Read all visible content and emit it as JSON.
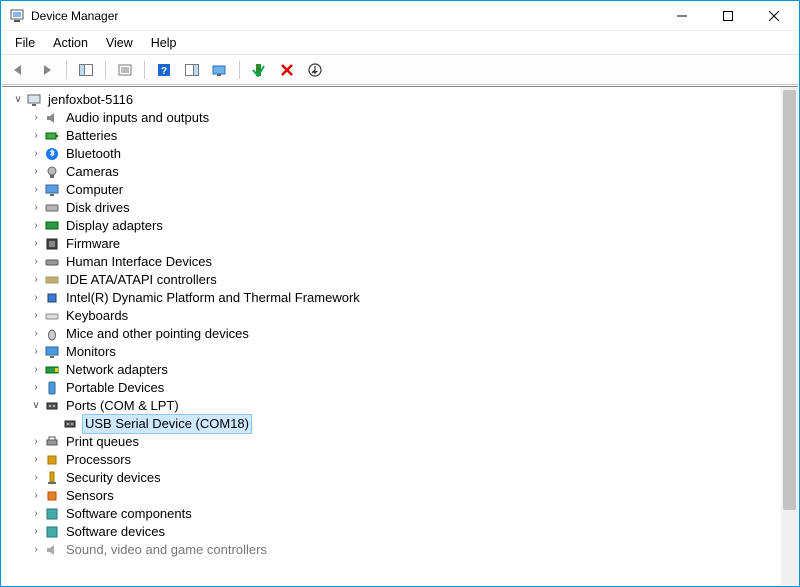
{
  "window": {
    "title": "Device Manager"
  },
  "menu": {
    "file": "File",
    "action": "Action",
    "view": "View",
    "help": "Help"
  },
  "tree": {
    "root": "jenfoxbot-5116",
    "items": {
      "audio": "Audio inputs and outputs",
      "batteries": "Batteries",
      "bluetooth": "Bluetooth",
      "cameras": "Cameras",
      "computer": "Computer",
      "disk": "Disk drives",
      "display": "Display adapters",
      "firmware": "Firmware",
      "hid": "Human Interface Devices",
      "ide": "IDE ATA/ATAPI controllers",
      "intel": "Intel(R) Dynamic Platform and Thermal Framework",
      "keyboards": "Keyboards",
      "mice": "Mice and other pointing devices",
      "monitors": "Monitors",
      "network": "Network adapters",
      "portable": "Portable Devices",
      "ports": "Ports (COM & LPT)",
      "ports_child": "USB Serial Device (COM18)",
      "printq": "Print queues",
      "processors": "Processors",
      "security": "Security devices",
      "sensors": "Sensors",
      "swcomp": "Software components",
      "swdev": "Software devices",
      "sound": "Sound, video and game controllers"
    }
  }
}
